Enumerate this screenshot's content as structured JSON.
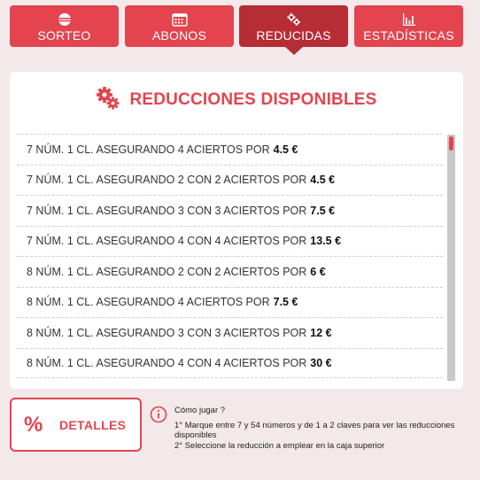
{
  "tabs": [
    {
      "label": "SORTEO",
      "icon": "lottery-ball-icon",
      "active": false
    },
    {
      "label": "ABONOS",
      "icon": "calendar-icon",
      "active": false
    },
    {
      "label": "REDUCIDAS",
      "icon": "gears-icon",
      "active": true
    },
    {
      "label": "ESTADÍSTICAS",
      "icon": "bar-chart-icon",
      "active": false
    }
  ],
  "panel": {
    "title": "REDUCCIONES DISPONIBLES",
    "title_icon": "gears-icon",
    "items": [
      {
        "text": "7 NÚM. 1 CL. ASEGURANDO 4 ACIERTOS POR",
        "price": "4.5 €"
      },
      {
        "text": "7 NÚM. 1 CL. ASEGURANDO 2 CON 2 ACIERTOS POR",
        "price": "4.5 €"
      },
      {
        "text": "7 NÚM. 1 CL. ASEGURANDO 3 CON 3 ACIERTOS POR",
        "price": "7.5 €"
      },
      {
        "text": "7 NÚM. 1 CL. ASEGURANDO 4 CON 4 ACIERTOS POR",
        "price": "13.5 €"
      },
      {
        "text": "8 NÚM. 1 CL. ASEGURANDO 2 CON 2 ACIERTOS POR",
        "price": "6 €"
      },
      {
        "text": "8 NÚM. 1 CL. ASEGURANDO 4 ACIERTOS POR",
        "price": "7.5 €"
      },
      {
        "text": "8 NÚM. 1 CL. ASEGURANDO 3 CON 3 ACIERTOS POR",
        "price": "12 €"
      },
      {
        "text": "8 NÚM. 1 CL. ASEGURANDO 4 CON 4 ACIERTOS POR",
        "price": "30 €"
      }
    ]
  },
  "detalles": {
    "symbol": "%",
    "label": "DETALLES"
  },
  "help": {
    "icon": "info-icon",
    "title": "Cómo jugar ?",
    "step1": "1° Marque entre 7 y 54 números y de 1 a 2 claves para ver las reducciones disponibles",
    "step2": "2° Seleccione la reducción a emplear en la caja superior"
  },
  "colors": {
    "accent": "#e3444e",
    "active_tab": "#b72d35",
    "background": "#f3e9ea"
  }
}
